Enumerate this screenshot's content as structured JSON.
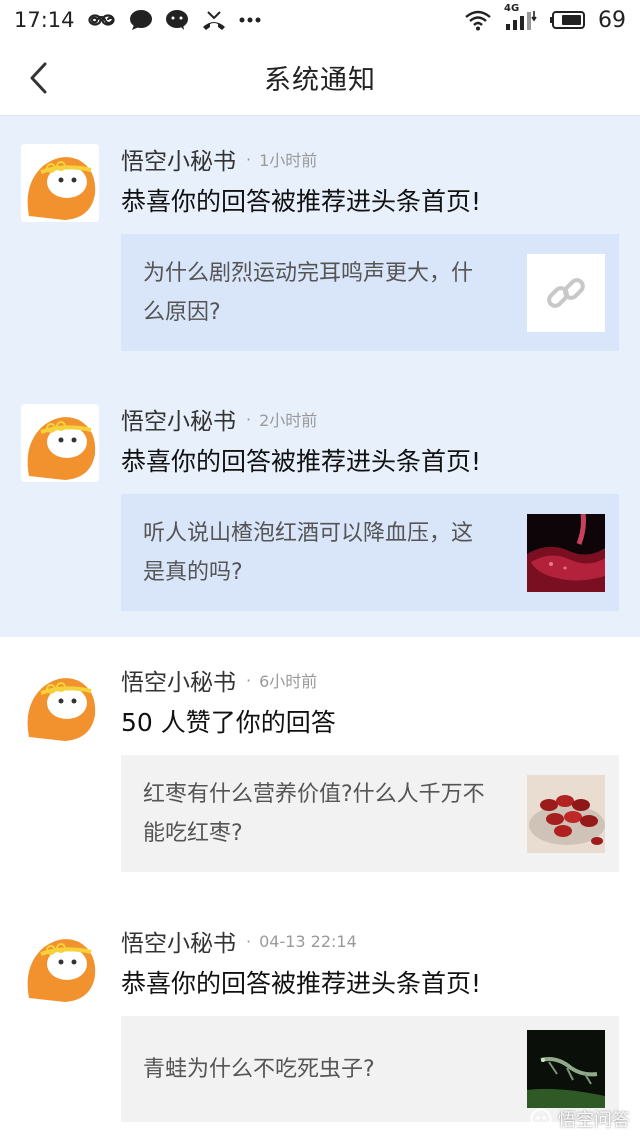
{
  "status_bar": {
    "time": "17:14",
    "network": "4G",
    "battery": "69",
    "left_icons": [
      "infinity-icon",
      "chat-bubble-icon",
      "message-icon",
      "missed-call-icon",
      "more-dots-icon"
    ],
    "right_icons": [
      "wifi-icon",
      "signal-icon",
      "battery-icon"
    ]
  },
  "nav": {
    "title": "系统通知"
  },
  "notifications": [
    {
      "sender": "悟空小秘书",
      "separator": "·",
      "time": "1小时前",
      "headline": "恭喜你的回答被推荐进头条首页!",
      "question": "为什么剧烈运动完耳鸣声更大，什么原因?",
      "thumb": "link-icon",
      "unread": true
    },
    {
      "sender": "悟空小秘书",
      "separator": "·",
      "time": "2小时前",
      "headline": "恭喜你的回答被推荐进头条首页!",
      "question": "听人说山楂泡红酒可以降血压，这是真的吗?",
      "thumb": "red-wine-photo",
      "unread": true
    },
    {
      "sender": "悟空小秘书",
      "separator": "·",
      "time": "6小时前",
      "headline": "50 人赞了你的回答",
      "question": "红枣有什么营养价值?什么人千万不能吃红枣?",
      "thumb": "red-dates-photo",
      "unread": false
    },
    {
      "sender": "悟空小秘书",
      "separator": "·",
      "time": "04-13 22:14",
      "headline": "恭喜你的回答被推荐进头条首页!",
      "question": "青蛙为什么不吃死虫子?",
      "thumb": "frog-photo",
      "unread": false
    }
  ],
  "watermark": "悟空问答",
  "colors": {
    "unread_bg": "#e8f0fc",
    "unread_card": "#d9e6fa",
    "read_card": "#f2f2f2",
    "avatar_orange": "#f2922e"
  }
}
